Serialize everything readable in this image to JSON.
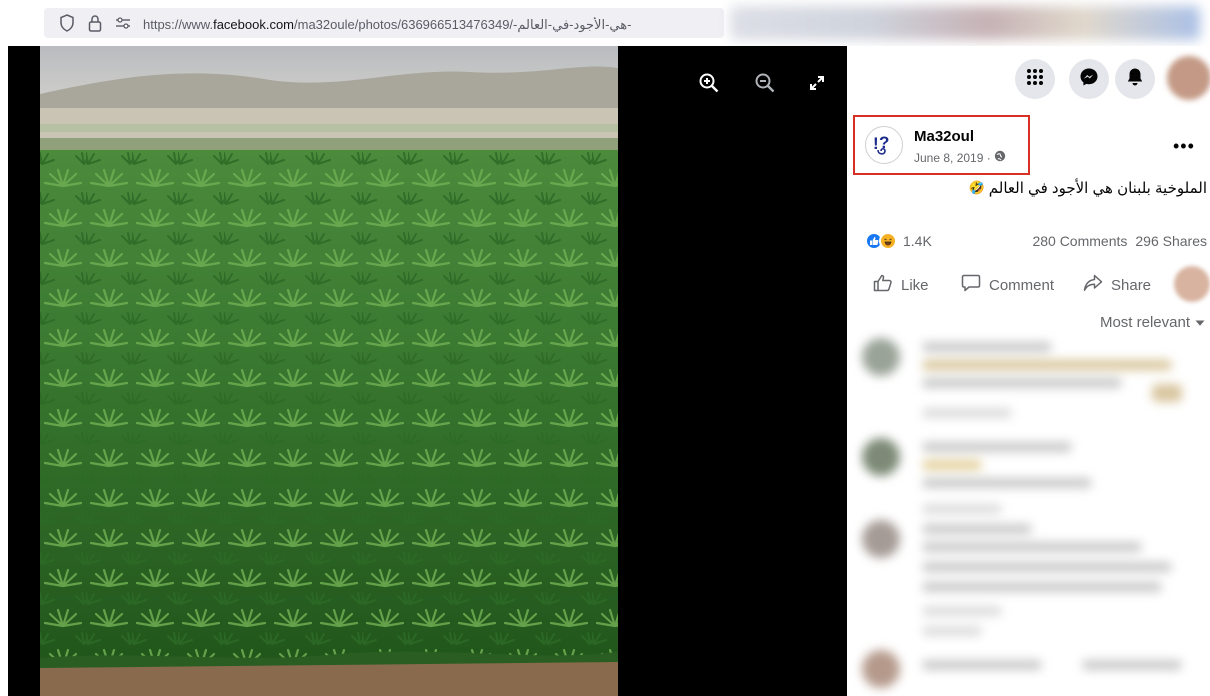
{
  "browser": {
    "url_prefix": "https://www.",
    "url_domain": "facebook.com",
    "url_path": "/ma32oule/photos/636966513476349/-هي-الأجود-في-العالم-",
    "shield_icon": "shield-icon",
    "lock_icon": "lock-icon",
    "permissions_icon": "permissions-icon"
  },
  "viewer": {
    "zoom_in_icon": "zoom-in-icon",
    "zoom_out_icon": "zoom-out-icon",
    "fullscreen_icon": "fullscreen-icon"
  },
  "top_icons": [
    "menu-grid-icon",
    "messenger-icon",
    "notifications-icon"
  ],
  "post": {
    "author": "Ma32oul",
    "date": "June 8, 2019 ·",
    "audience_icon": "globe-icon",
    "text": "الملوخية بلبنان هي الأجود في العالم",
    "emoji": "🤣",
    "reactions_count": "1.4K",
    "comments": "280 Comments",
    "shares": "296 Shares"
  },
  "actions": {
    "like": "Like",
    "comment": "Comment",
    "share": "Share"
  },
  "comments_sort": "Most relevant",
  "colors": {
    "highlight_box": "#d93025",
    "like_blue": "#1877f2",
    "haha_yellow": "#f7b125",
    "secondary_text": "#65676b"
  }
}
